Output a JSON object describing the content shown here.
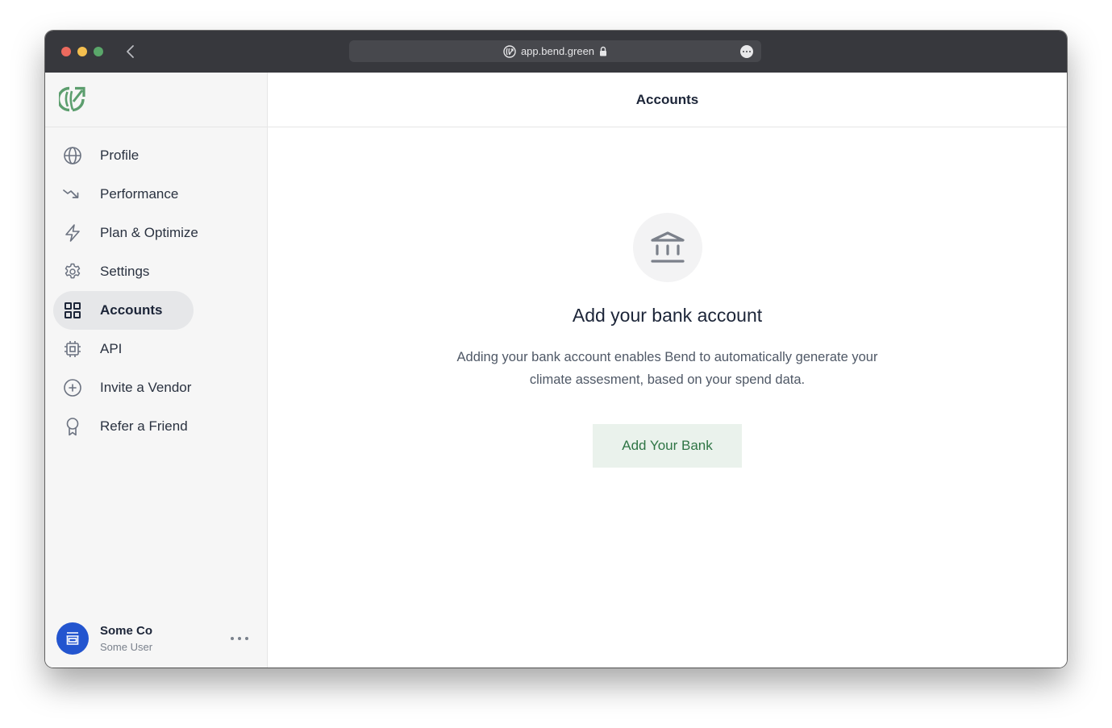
{
  "browser": {
    "url": "app.bend.green",
    "secure": true,
    "icons": {
      "back": "chevron-left-icon",
      "site": "bend-logo-icon",
      "lock": "lock-icon",
      "more": "more-horizontal-icon"
    }
  },
  "brand": {
    "logo": "bend-logo-icon",
    "color": "#5c9e6e"
  },
  "sidebar": {
    "items": [
      {
        "label": "Profile",
        "icon": "globe-icon",
        "active": false
      },
      {
        "label": "Performance",
        "icon": "trending-down-icon",
        "active": false
      },
      {
        "label": "Plan & Optimize",
        "icon": "lightning-icon",
        "active": false
      },
      {
        "label": "Settings",
        "icon": "gear-icon",
        "active": false
      },
      {
        "label": "Accounts",
        "icon": "grid-icon",
        "active": true
      },
      {
        "label": "API",
        "icon": "chip-icon",
        "active": false
      },
      {
        "label": "Invite a Vendor",
        "icon": "plus-circle-icon",
        "active": false
      },
      {
        "label": "Refer a Friend",
        "icon": "award-icon",
        "active": false
      }
    ],
    "user": {
      "company": "Some Co",
      "name": "Some User",
      "avatar_icon": "storefront-icon",
      "avatar_color": "#2355cf",
      "menu_icon": "more-horizontal-icon"
    }
  },
  "main": {
    "title": "Accounts",
    "empty_state": {
      "icon": "bank-icon",
      "title": "Add your bank account",
      "description": "Adding your bank account enables Bend to automatically generate your climate assesment, based on your spend data.",
      "button_label": "Add Your Bank"
    }
  }
}
